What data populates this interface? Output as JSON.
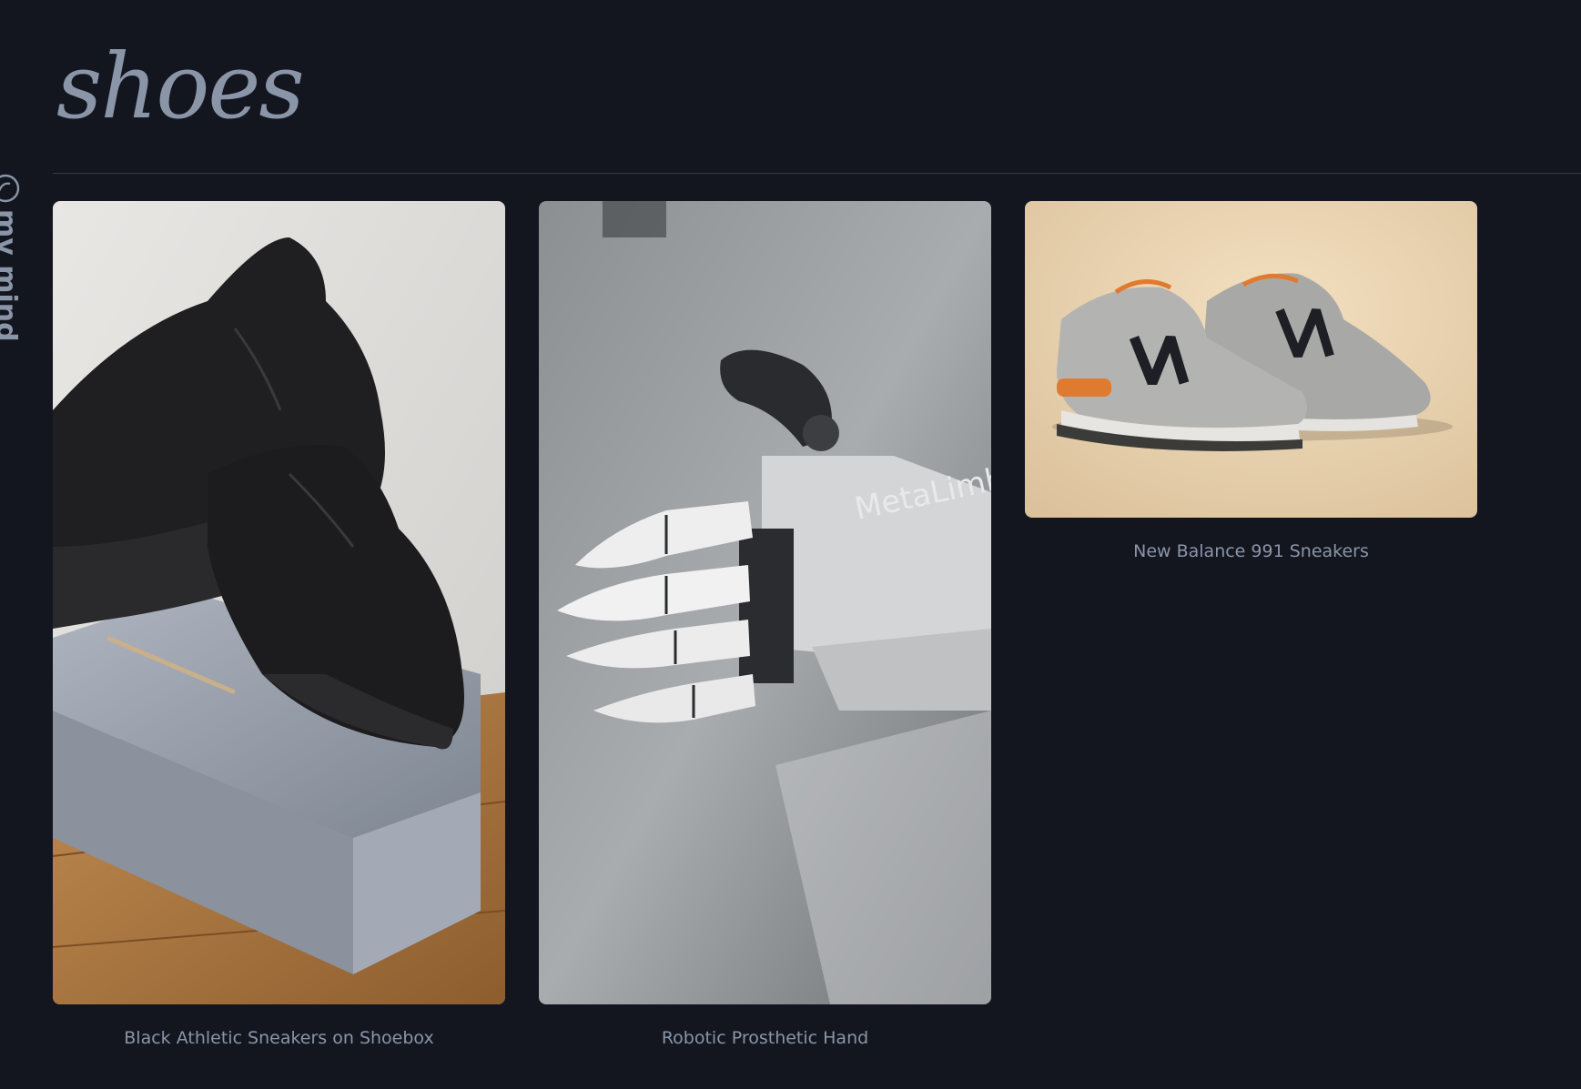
{
  "brand": {
    "name": "my mind",
    "icon": "brain-icon"
  },
  "page": {
    "title": "shoes"
  },
  "cards": [
    {
      "caption": "Black Athletic Sneakers on Shoebox"
    },
    {
      "caption": "Robotic Prosthetic Hand",
      "photo_text": "MetaLimbs"
    },
    {
      "caption": "New Balance 991 Sneakers"
    }
  ],
  "colors": {
    "background": "#13161f",
    "text_muted": "#8b95a8",
    "divider": "#333a48"
  }
}
